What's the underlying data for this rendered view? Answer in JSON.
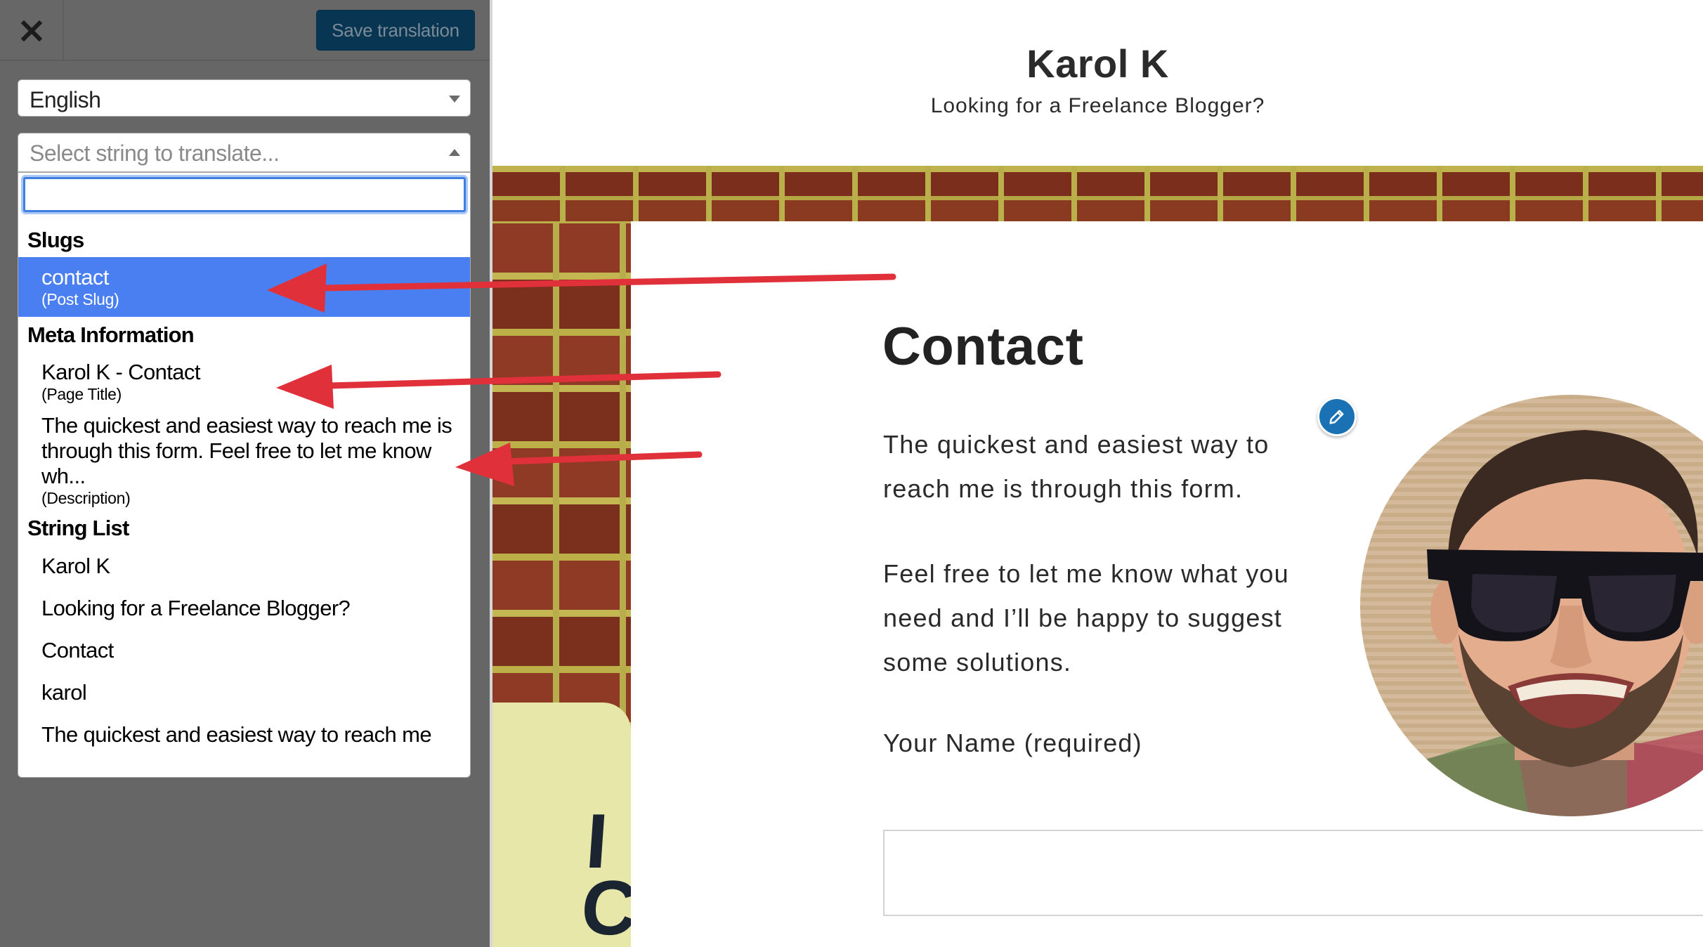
{
  "sidebar": {
    "close_icon": "close-x-icon",
    "save_button_label": "Save translation",
    "language_select": {
      "value": "English",
      "icon": "caret-down-icon"
    },
    "string_select": {
      "placeholder": "Select string to translate...",
      "icon": "caret-up-icon",
      "search_value": "",
      "groups": [
        {
          "label": "Slugs",
          "options": [
            {
              "text": "contact",
              "type": "(Post Slug)",
              "selected": true
            }
          ]
        },
        {
          "label": "Meta Information",
          "options": [
            {
              "text": "Karol K - Contact",
              "type": "(Page Title)"
            },
            {
              "text": "The quickest and easiest way to reach me is through this form. Feel free to let me know wh...",
              "type": "(Description)"
            }
          ]
        },
        {
          "label": "String List",
          "options": [
            {
              "text": "Karol K"
            },
            {
              "text": "Looking for a Freelance Blogger?"
            },
            {
              "text": "Contact"
            },
            {
              "text": "karol"
            },
            {
              "text": "The quickest and easiest way to reach me"
            }
          ]
        }
      ]
    }
  },
  "preview": {
    "site_title": "Karol K",
    "site_tagline": "Looking for a Freelance Blogger?",
    "page_heading": "Contact",
    "paragraph_1": "The quickest and easiest way to reach me is through this form.",
    "paragraph_2": "Feel free to let me know what you need and I’ll be happy to suggest some solutions.",
    "name_label": "Your Name (required)",
    "name_value": "",
    "edit_icon": "pencil-icon",
    "avatar_alt": "author-photo",
    "shirt_text": "I\nCO"
  },
  "annotations": {
    "arrow_color": "#e0313b",
    "arrows": [
      {
        "from": "page slug",
        "to": "Slugs option 'contact'"
      },
      {
        "from": "page heading 'Contact'",
        "to": "Page Title option"
      },
      {
        "from": "intro paragraph",
        "to": "Description option"
      }
    ]
  },
  "colors": {
    "sidebar_bg": "#666666",
    "save_button_bg": "#073552",
    "selected_option_bg": "#4a7ff1",
    "focus_ring": "#3f7fdf",
    "pencil_button_bg": "#1a72b5"
  }
}
